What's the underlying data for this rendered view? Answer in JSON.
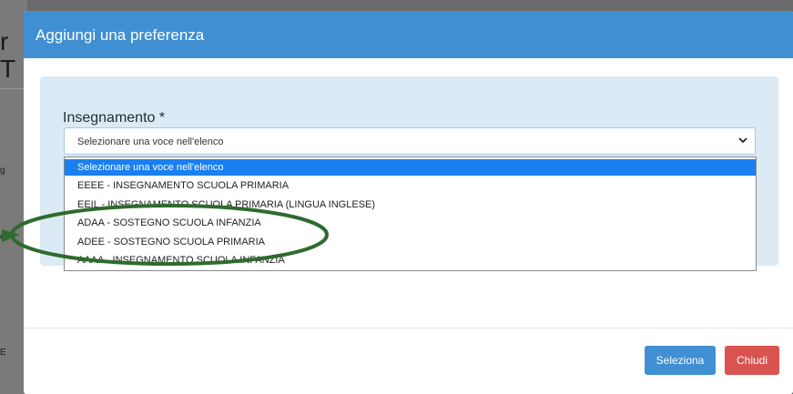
{
  "background": {
    "chars": [
      "r",
      "T",
      "g",
      "e",
      "E"
    ]
  },
  "modal": {
    "title": "Aggiungi una preferenza",
    "field_label": "Insegnamento *",
    "select": {
      "value": "Selezionare una voce nell'elenco",
      "options": [
        "Selezionare una voce nell'elenco",
        "EEEE - INSEGNAMENTO SCUOLA PRIMARIA",
        "EEIL - INSEGNAMENTO SCUOLA PRIMARIA (LINGUA INGLESE)",
        "ADAA - SOSTEGNO SCUOLA INFANZIA",
        "ADEE - SOSTEGNO SCUOLA PRIMARIA",
        "AAAA - INSEGNAMENTO SCUOLA INFANZIA"
      ],
      "selected_index": 0
    },
    "buttons": {
      "select_label": "Seleziona",
      "close_label": "Chiudi"
    }
  },
  "colors": {
    "header": "#3f8fd2",
    "panel": "#dbeaf5",
    "selected_option": "#1a7ff0",
    "danger": "#d9534f",
    "annotation": "#2e6b2e"
  }
}
